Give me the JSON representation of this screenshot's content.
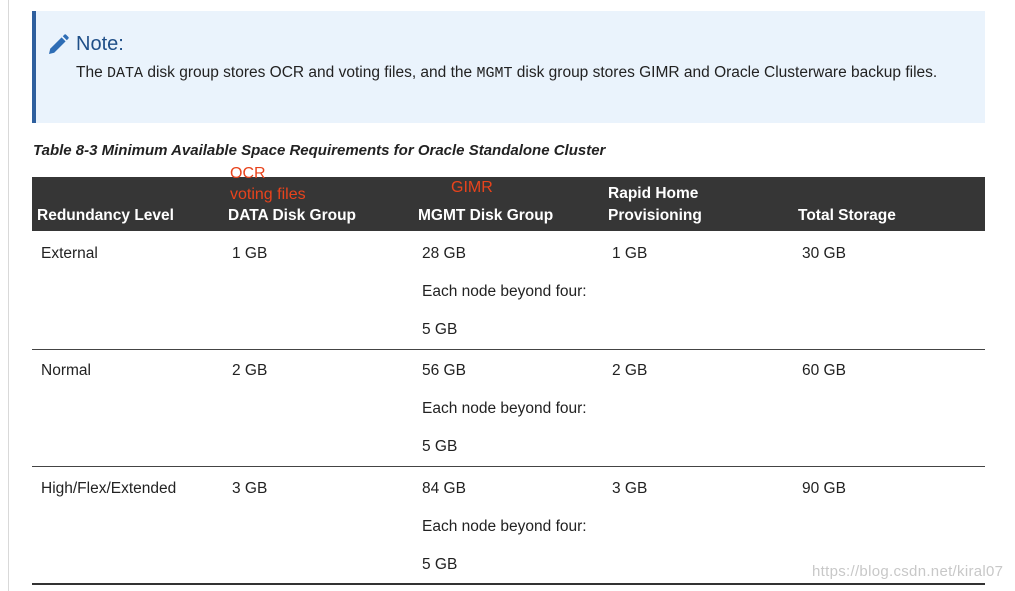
{
  "note": {
    "title": "Note:",
    "text_1": "The ",
    "code_1": "DATA",
    "text_2": " disk group stores OCR and voting files, and the ",
    "code_2": "MGMT",
    "text_3": " disk group stores GIMR and Oracle Clusterware backup files.",
    "icon": "pencil-icon",
    "accent_color": "#2e5f9e",
    "background_color": "#eaf3fc"
  },
  "table": {
    "caption": "Table 8-3 Minimum Available Space Requirements for Oracle Standalone Cluster",
    "header_background": "#363636",
    "headers": {
      "redundancy": "Redundancy Level",
      "data": "DATA Disk Group",
      "mgmt": "MGMT Disk Group",
      "rhp_line1": "Rapid Home",
      "rhp_line2": "Provisioning",
      "total": "Total Storage"
    },
    "annotations": {
      "data_line1": "OCR",
      "data_line2": "voting files",
      "mgmt": "GIMR",
      "color": "#e8431c"
    },
    "rows": [
      {
        "redundancy": "External",
        "data": "1 GB",
        "mgmt": "28 GB",
        "mgmt_note": "Each node beyond four:",
        "mgmt_extra": "5 GB",
        "rhp": "1 GB",
        "total": "30 GB"
      },
      {
        "redundancy": "Normal",
        "data": "2 GB",
        "mgmt": "56 GB",
        "mgmt_note": "Each node beyond four:",
        "mgmt_extra": "5 GB",
        "rhp": "2 GB",
        "total": "60 GB"
      },
      {
        "redundancy": "High/Flex/Extended",
        "data": "3 GB",
        "mgmt": "84 GB",
        "mgmt_note": "Each node beyond four:",
        "mgmt_extra": "5 GB",
        "rhp": "3 GB",
        "total": "90 GB"
      }
    ]
  },
  "watermark": "https://blog.csdn.net/kiral07"
}
